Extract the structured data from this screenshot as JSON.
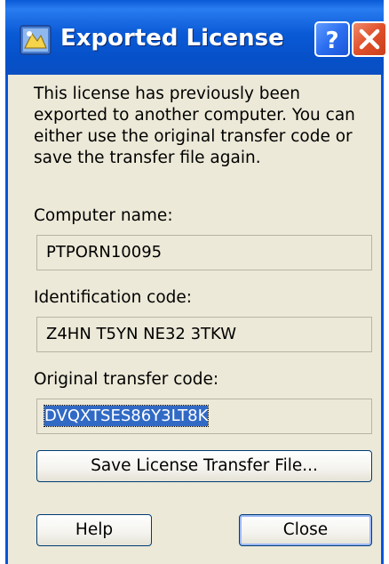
{
  "window": {
    "title": "Exported License",
    "icon": "license-app-icon",
    "title_buttons": [
      "help-icon",
      "close-icon"
    ]
  },
  "message": "This license has previously been exported to another computer.  You can either use the original transfer code or save the transfer file again.",
  "fields": {
    "computer_name": {
      "label": "Computer name:",
      "value": "PTPORN10095"
    },
    "identification_code": {
      "label": "Identification code:",
      "value": "Z4HN T5YN NE32 3TKW"
    },
    "original_transfer_code": {
      "label": "Original transfer code:",
      "value": "DVQXTSES86Y3LT8K"
    }
  },
  "buttons": {
    "save_transfer_file": "Save License Transfer File...",
    "help": "Help",
    "close": "Close"
  },
  "colors": {
    "titlebar": "#0a5ad6",
    "dialog_bg": "#ece9d8",
    "selection": "#316ac5",
    "close_red": "#e0502a"
  }
}
